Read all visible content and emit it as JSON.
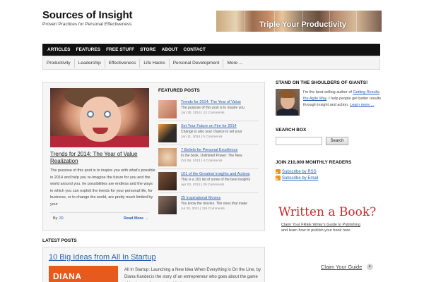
{
  "header": {
    "site_title": "Sources of Insight",
    "tagline": "Proven Practices for Personal Effectiveness",
    "banner_text": "Triple Your Productivity"
  },
  "nav_primary": [
    "ARTICLES",
    "FEATURES",
    "FREE STUFF",
    "STORE",
    "ABOUT",
    "CONTACT"
  ],
  "nav_secondary": [
    "Productivity",
    "Leadership",
    "Effectiveness",
    "Life Hacks",
    "Personal Development",
    "More ..."
  ],
  "featured_main": {
    "title": "Trends for 2014: The Year of Value Realization",
    "excerpt": "The purpose of this post is to inspire you with what's possible in 2014 and help you re-imagine the future for you and the world around you. he possibilities are endless and the ways in which you can exploit the trends for your personal life, for business, or to change the world, are pretty much limited by your",
    "byline_prefix": "By",
    "byline_author": "JD",
    "read_more": "Read More →"
  },
  "featured_posts": {
    "heading": "FEATURED POSTS",
    "items": [
      {
        "title": "Trends for 2014: The Year of Value",
        "excerpt": "The purpose of this post is to inspire you",
        "meta": "Jan 30, 2014 | 12 Comments",
        "thumb_color": "#c9866a"
      },
      {
        "title": "Set Your Future on Fire for 2014",
        "excerpt": "Change is also your chance to set your",
        "meta": "Jan 11, 2014 | 5 Comments",
        "thumb_color": "#2f2a26"
      },
      {
        "title": "7 Beliefs for Personal Excellence",
        "excerpt": "In the book, Unlimited Power: The New",
        "meta": "Oct 08, 2013 | 4 Comments",
        "thumb_color": "#d8b08e"
      },
      {
        "title": "101 of the Greatest Insights and Actions",
        "excerpt": "This is a 101 list of some of the best insights",
        "meta": "Apr 02, 2012 | 28 Comments",
        "thumb_color": "#4a3226"
      },
      {
        "title": "25 Inspirational Movies",
        "excerpt": "You know the movies. The ones that make",
        "meta": "Jul 20, 2011 | 115 Comments",
        "thumb_color": "#3a3030"
      }
    ]
  },
  "latest_posts": {
    "heading": "LATEST POSTS",
    "title": "10 Big Ideas from All In Startup",
    "thumb_text": "DIANA KANDER",
    "excerpt": "All In Startup: Launching a New Idea When Everything is On the Line, by Diana Kander,is the story of an entrepreneur who goes about the game of business all wrong. Luckily he"
  },
  "sidebar": {
    "giants_heading": "STAND ON THE SHOULDERS OF GIANTS!",
    "bio_1": "I'm the best-selling author of ",
    "bio_link_book": "Getting Results the Agile Way",
    "bio_2": ". I help people get better results through insight and action. ",
    "bio_link_more": "Learn more ...",
    "search_heading": "SEARCH BOX",
    "search_value": "",
    "search_button": "Search",
    "readers_heading": "JOIN 210,000 MONTHLY READERS",
    "subscribe_rss": "Subscribe by RSS",
    "subscribe_email": "Subscribe by Email"
  },
  "ad": {
    "headline": "Written a Book?",
    "line1": "Claim Your FREE Writer's Guide to Publishing",
    "line2": "and learn how to publish your book now.",
    "cta": "Claim Your Guide",
    "cta_icon": "arrow-right-icon"
  },
  "colors": {
    "nav_primary_bg": "#111111",
    "link": "#2a5db0",
    "ad_headline": "#c62a2a",
    "rss_orange": "#f29320",
    "kander_orange": "#e65a1d"
  }
}
